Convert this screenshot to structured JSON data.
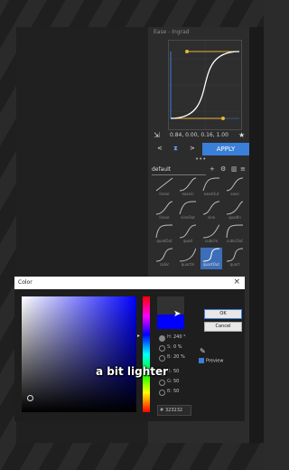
{
  "panel": {
    "title": "Ease - Ingrad"
  },
  "bezier": {
    "values": "0.84, 0.00, 0.16, 1.00"
  },
  "nav": {
    "prev": "<",
    "mid": "⧗",
    "next": ">",
    "apply": "APPLY"
  },
  "more": "•••",
  "presets": {
    "selected": "default",
    "items": [
      {
        "label": "linear"
      },
      {
        "label": "easein"
      },
      {
        "label": "easeOut"
      },
      {
        "label": "ease"
      },
      {
        "label": "linear"
      },
      {
        "label": "sineOut"
      },
      {
        "label": "sine"
      },
      {
        "label": "quadIn"
      },
      {
        "label": "quadOut"
      },
      {
        "label": "quad"
      },
      {
        "label": "cubicIn"
      },
      {
        "label": "cubicOut"
      },
      {
        "label": "cubic"
      },
      {
        "label": "quartIn"
      },
      {
        "label": "quartOut"
      },
      {
        "label": "quart"
      }
    ]
  },
  "dialog": {
    "title": "Color",
    "ok": "OK",
    "cancel": "Cancel",
    "preview": "Preview",
    "fields": [
      {
        "key": "H:",
        "value": "240 °"
      },
      {
        "key": "S:",
        "value": "0 %"
      },
      {
        "key": "B:",
        "value": "20 %"
      },
      {
        "key": "R:",
        "value": "50"
      },
      {
        "key": "G:",
        "value": "50"
      },
      {
        "key": "B:",
        "value": "50"
      }
    ],
    "hex_prefix": "#",
    "hex": "323232"
  },
  "caption": "a bit lighter",
  "colors": {
    "accent": "#3a7fd8",
    "pure_blue": "#0000ff",
    "current": "#323232"
  }
}
